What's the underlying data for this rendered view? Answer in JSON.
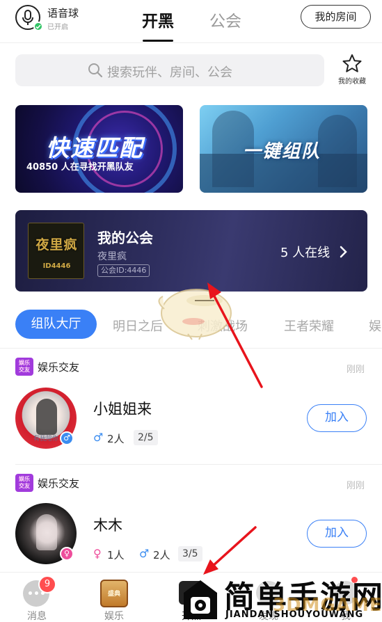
{
  "header": {
    "voice_ball": {
      "title": "语音球",
      "status": "已开启"
    },
    "tabs": [
      {
        "label": "开黑",
        "active": true
      },
      {
        "label": "公会",
        "active": false
      }
    ],
    "my_room_label": "我的房间"
  },
  "search": {
    "placeholder": "搜索玩伴、房间、公会",
    "favorites_label": "我的收藏"
  },
  "banners": {
    "quick_match": {
      "title": "快速匹配",
      "subtitle": "40850 人在寻找开黑队友"
    },
    "team_up": {
      "title": "一键组队"
    }
  },
  "guild": {
    "section_title": "我的公会",
    "name": "夜里疯",
    "id_text": "公会ID:4446",
    "online_text": "5 人在线",
    "avatar_title": "夜里疯",
    "avatar_id": "ID4446"
  },
  "categories": {
    "active": "组队大厅",
    "items": [
      "明日之后",
      "刺激战场",
      "王者荣耀",
      "娱"
    ]
  },
  "rooms": [
    {
      "tag_icon": "娱乐交友",
      "tag": "娱乐交友",
      "time": "刚刚",
      "name": "小姐姐来",
      "avatar_caption": "有我陪你",
      "avatar_gender": "male",
      "male_count": "2人",
      "seats": "2/5",
      "join_label": "加入"
    },
    {
      "tag_icon": "娱乐交友",
      "tag": "娱乐交友",
      "time": "刚刚",
      "name": "木木",
      "avatar_gender": "female",
      "female_count": "1人",
      "male_count": "2人",
      "seats": "3/5",
      "join_label": "加入"
    }
  ],
  "bottom_nav": [
    {
      "label": "消息",
      "badge": "9",
      "icon": "message-icon"
    },
    {
      "label": "娱乐",
      "icon": "entertainment-icon",
      "icon_text": "盛典"
    },
    {
      "label": "开黑",
      "icon": "play-icon",
      "active": true
    },
    {
      "label": "发现",
      "icon": "discover-icon"
    },
    {
      "label": "我",
      "icon": "profile-icon"
    }
  ],
  "watermark": {
    "title": "简单手游网",
    "subtitle": "JIANDANSHOUYOUWANG",
    "secondary": "3DMGAME"
  },
  "colors": {
    "accent": "#3a80f6",
    "male": "#3a8cf0",
    "female": "#ee4d9b",
    "badge_red": "#ff4d4f",
    "annotation_arrow": "#e8141c"
  }
}
